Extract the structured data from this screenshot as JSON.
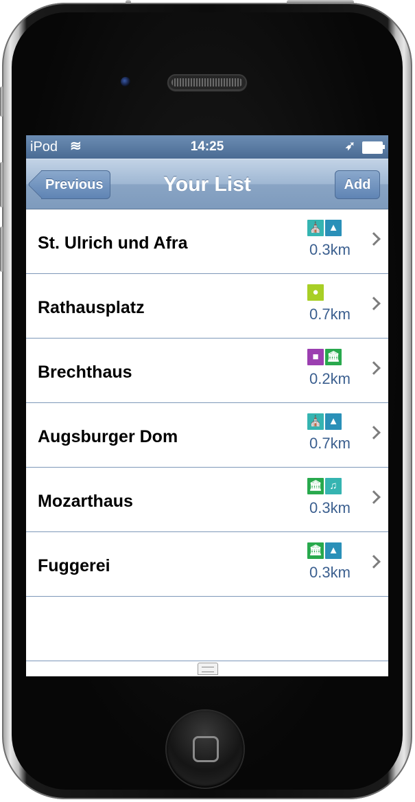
{
  "status_bar": {
    "carrier": "iPod",
    "time": "14:25"
  },
  "nav": {
    "back_label": "Previous",
    "title": "Your List",
    "add_label": "Add"
  },
  "items": [
    {
      "name": "St. Ulrich und Afra",
      "distance": "0.3km",
      "icons": [
        {
          "name": "church-icon",
          "glyph": "⛪",
          "color": "#35b4b1"
        },
        {
          "name": "landmark-icon",
          "glyph": "▲",
          "color": "#2a90b8"
        }
      ]
    },
    {
      "name": "Rathausplatz",
      "distance": "0.7km",
      "icons": [
        {
          "name": "location-pin-icon",
          "glyph": "●",
          "color": "#a8cf26"
        }
      ]
    },
    {
      "name": "Brechthaus",
      "distance": "0.2km",
      "icons": [
        {
          "name": "book-icon",
          "glyph": "■",
          "color": "#9b3fb0"
        },
        {
          "name": "museum-icon",
          "glyph": "🏛",
          "color": "#28a94d"
        }
      ]
    },
    {
      "name": "Augsburger Dom",
      "distance": "0.7km",
      "icons": [
        {
          "name": "church-icon",
          "glyph": "⛪",
          "color": "#35b4b1"
        },
        {
          "name": "landmark-icon",
          "glyph": "▲",
          "color": "#2a90b8"
        }
      ]
    },
    {
      "name": "Mozarthaus",
      "distance": "0.3km",
      "icons": [
        {
          "name": "museum-icon",
          "glyph": "🏛",
          "color": "#28a94d"
        },
        {
          "name": "music-icon",
          "glyph": "♫",
          "color": "#35b4b1"
        }
      ]
    },
    {
      "name": "Fuggerei",
      "distance": "0.3km",
      "icons": [
        {
          "name": "museum-icon",
          "glyph": "🏛",
          "color": "#28a94d"
        },
        {
          "name": "landmark-icon",
          "glyph": "▲",
          "color": "#2a90b8"
        }
      ]
    }
  ],
  "colors": {
    "nav_bar": "#8fa9c8",
    "status_bar": "#567aa2",
    "distance_text": "#3b5f8f",
    "separator": "#7c97b8"
  }
}
